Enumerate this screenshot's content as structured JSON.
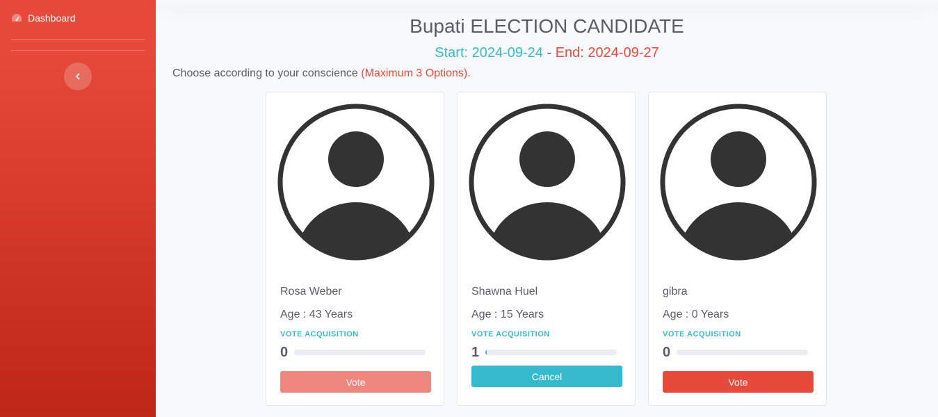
{
  "sidebar": {
    "items": [
      {
        "label": "Dashboard",
        "icon": "tachometer-icon"
      }
    ],
    "toggle_icon": "chevron-left-icon"
  },
  "election": {
    "title": "Bupati ELECTION CANDIDATE",
    "start_label": "Start: 2024-09-24",
    "separator": "-",
    "end_label": "End: 2024-09-27",
    "instruction": "Choose according to your conscience",
    "max_note": "(Maximum 3 Options)."
  },
  "vote_acquisition_label": "VOTE ACQUISITION",
  "candidates": [
    {
      "name": "Rosa Weber",
      "age": "Age : 43 Years",
      "votes": "0",
      "progress_fraction": 0.0,
      "button_label": "Vote",
      "button_color": "#f0877c"
    },
    {
      "name": "Shawna Huel",
      "age": "Age : 15 Years",
      "votes": "1",
      "progress_fraction": 0.01,
      "button_label": "Cancel",
      "button_color": "#36b9cc"
    },
    {
      "name": "gibra",
      "age": "Age : 0 Years",
      "votes": "0",
      "progress_fraction": 0.0,
      "button_label": "Vote",
      "button_color": "#e74a3b"
    }
  ],
  "colors": {
    "sidebar": "#e74a3b",
    "info": "#36b9cc",
    "danger": "#e74a3b",
    "avatar": "#333333"
  }
}
